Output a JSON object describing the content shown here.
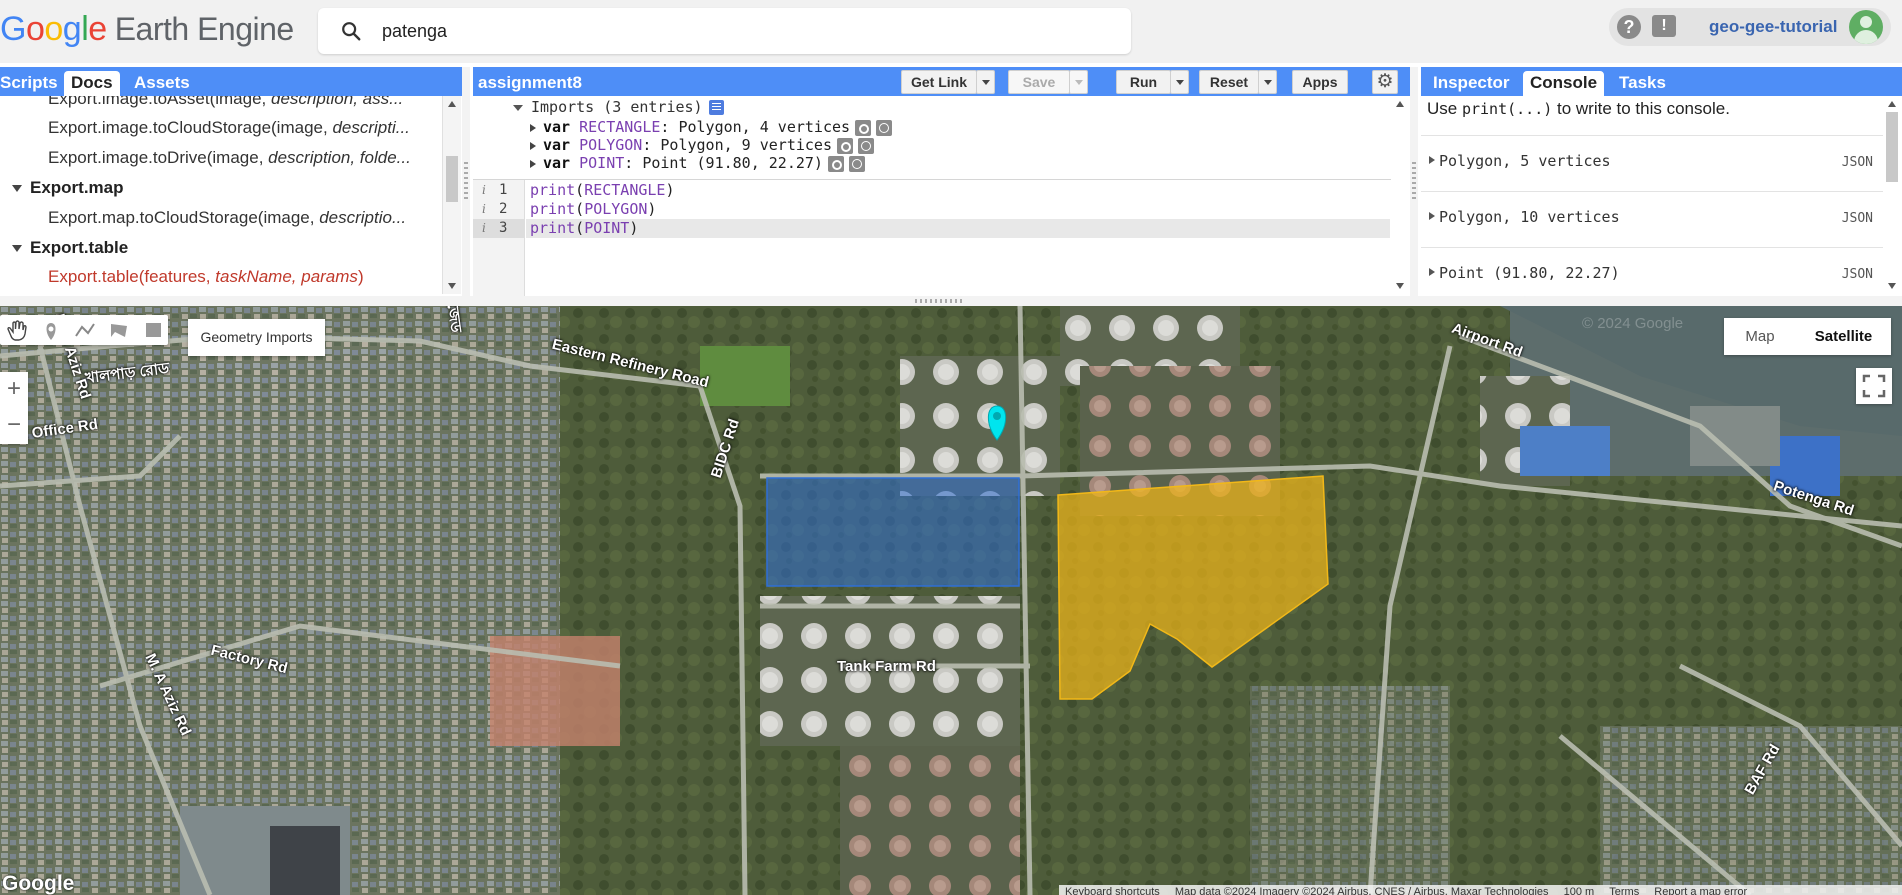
{
  "app": {
    "logo_google": [
      "G",
      "o",
      "o",
      "g",
      "l",
      "e"
    ],
    "logo_suffix": "Earth Engine",
    "search_value": "patenga",
    "user": "geo-gee-tutorial"
  },
  "left_panel": {
    "tabs": [
      "Scripts",
      "Docs",
      "Assets"
    ],
    "active_tab": "Docs",
    "rows": [
      {
        "type": "fn",
        "name": "Export.image.toAsset(image, ",
        "args": "description, ass..."
      },
      {
        "type": "fn",
        "name": "Export.image.toCloudStorage(image, ",
        "args": "descripti..."
      },
      {
        "type": "fn",
        "name": "Export.image.toDrive(image, ",
        "args": "description, folde..."
      },
      {
        "type": "grp",
        "name": "Export.map"
      },
      {
        "type": "fn",
        "name": "Export.map.toCloudStorage(image, ",
        "args": "descriptio..."
      },
      {
        "type": "grp",
        "name": "Export.table"
      },
      {
        "type": "fn-red",
        "name": "Export.table(features, ",
        "args": "taskName, params",
        "close": ")"
      }
    ]
  },
  "editor": {
    "script_name": "assignment8",
    "buttons": {
      "get_link": "Get Link",
      "save": "Save",
      "run": "Run",
      "reset": "Reset",
      "apps": "Apps"
    },
    "imports_header": "Imports (3 entries)",
    "imports": [
      {
        "kw": "var",
        "name": "RECTANGLE",
        "desc": ": Polygon, 4 vertices"
      },
      {
        "kw": "var",
        "name": "POLYGON",
        "desc": ": Polygon, 9 vertices"
      },
      {
        "kw": "var",
        "name": "POINT",
        "desc": ": Point (91.80, 22.27)"
      }
    ],
    "lines": [
      {
        "num": "1",
        "fn": "print",
        "arg": "RECTANGLE"
      },
      {
        "num": "2",
        "fn": "print",
        "arg": "POLYGON"
      },
      {
        "num": "3",
        "fn": "print",
        "arg": "POINT"
      }
    ]
  },
  "right_panel": {
    "tabs": [
      "Inspector",
      "Console",
      "Tasks"
    ],
    "active_tab": "Console",
    "hint_pre": "Use ",
    "hint_code": "print(...)",
    "hint_post": " to write to this console.",
    "entries": [
      {
        "text": "Polygon, 5 vertices",
        "tag": "JSON"
      },
      {
        "text": "Polygon, 10 vertices",
        "tag": "JSON"
      },
      {
        "text": "Point (91.80, 22.27)",
        "tag": "JSON"
      }
    ]
  },
  "map": {
    "geometry_imports": "Geometry Imports",
    "map_type_map": "Map",
    "map_type_satellite": "Satellite",
    "zoom_in": "+",
    "zoom_out": "−",
    "google_mark": "Google",
    "attribution": [
      "Keyboard shortcuts",
      "Map data ©2024 Imagery ©2024 Airbus, CNES / Airbus, Maxar Technologies",
      "100 m",
      "Terms",
      "Report a map error"
    ],
    "labels": [
      "Eastern Refinery Road",
      "খালপাড় রোড",
      "Post Office Rd",
      "M. A Aziz Rd",
      "BIDC Rd",
      "Airport Rd",
      "Potenga Rd",
      "Tank Farm Rd",
      "Factory Rd",
      "M. A Aziz Rd",
      "BAF Rd",
      "ইপিজেড",
      "© 2024 Google"
    ],
    "rectangle_color": "#2f6fd6",
    "polygon_color": "#f2b818",
    "point_color": "#00e5ee"
  }
}
